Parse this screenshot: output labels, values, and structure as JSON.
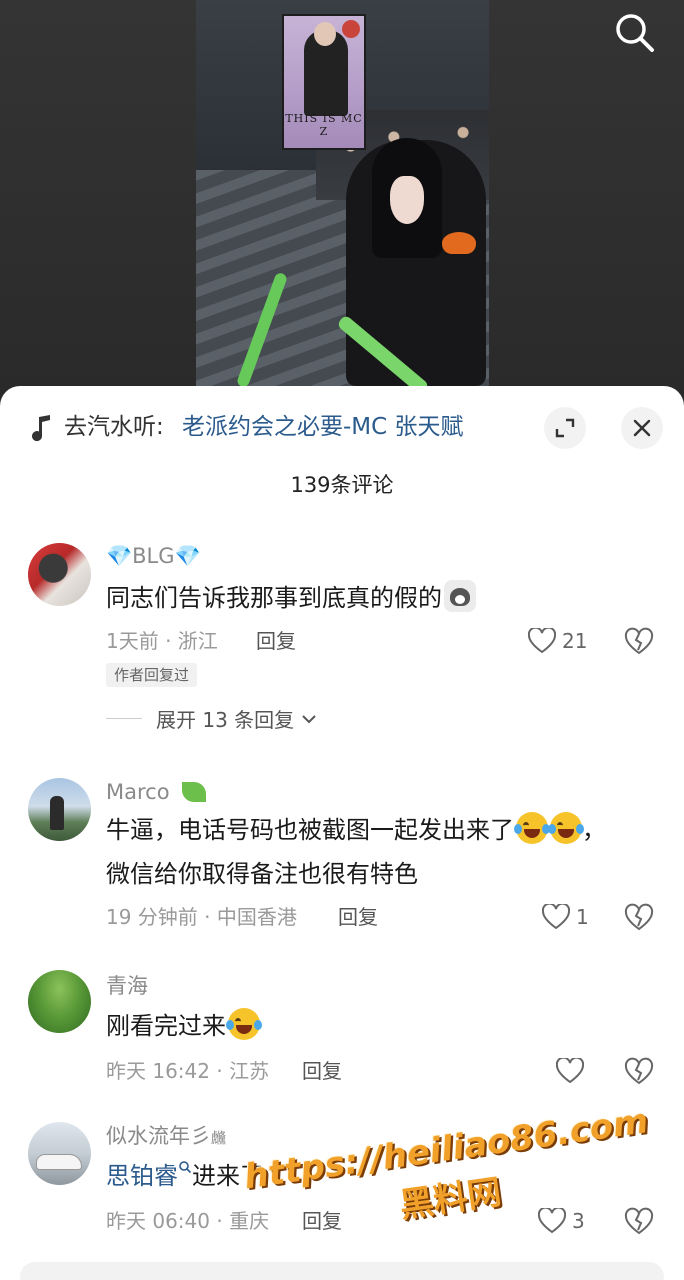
{
  "video": {
    "poster_text": "THIS IS MC Z"
  },
  "music": {
    "prefix": "去汽水听:",
    "title": "老派约会之必要-MC 张天赋"
  },
  "comment_count": "139条评论",
  "comments": [
    {
      "username": "💎BLG💎",
      "text": "同志们告诉我那事到底真的假的",
      "meta": "1天前 · 浙江",
      "reply": "回复",
      "likes": "21",
      "tag": "作者回复过",
      "expand": "展开 13 条回复"
    },
    {
      "username": "Marco",
      "text_line1": "牛逼，电话号码也被截图一起发出来了",
      "text_line1_end": "，",
      "text_line2": "微信给你取得备注也很有特色",
      "meta": "19 分钟前 · 中国香港",
      "reply": "回复",
      "likes": "1"
    },
    {
      "username": "青海",
      "text": "刚看完过来",
      "meta": "昨天 16:42 · 江苏",
      "reply": "回复",
      "likes": ""
    },
    {
      "username": "似水流年彡",
      "username_suffix": "虪",
      "mention": "思铂睿",
      "text": "进来了",
      "meta": "昨天 06:40 · 重庆",
      "reply": "回复",
      "likes": "3"
    }
  ],
  "watermark": {
    "url": "https://heiliao86.com",
    "name": "黑料网"
  },
  "colors": {
    "link": "#2b5a8c",
    "watermark": "#f1a12a"
  }
}
